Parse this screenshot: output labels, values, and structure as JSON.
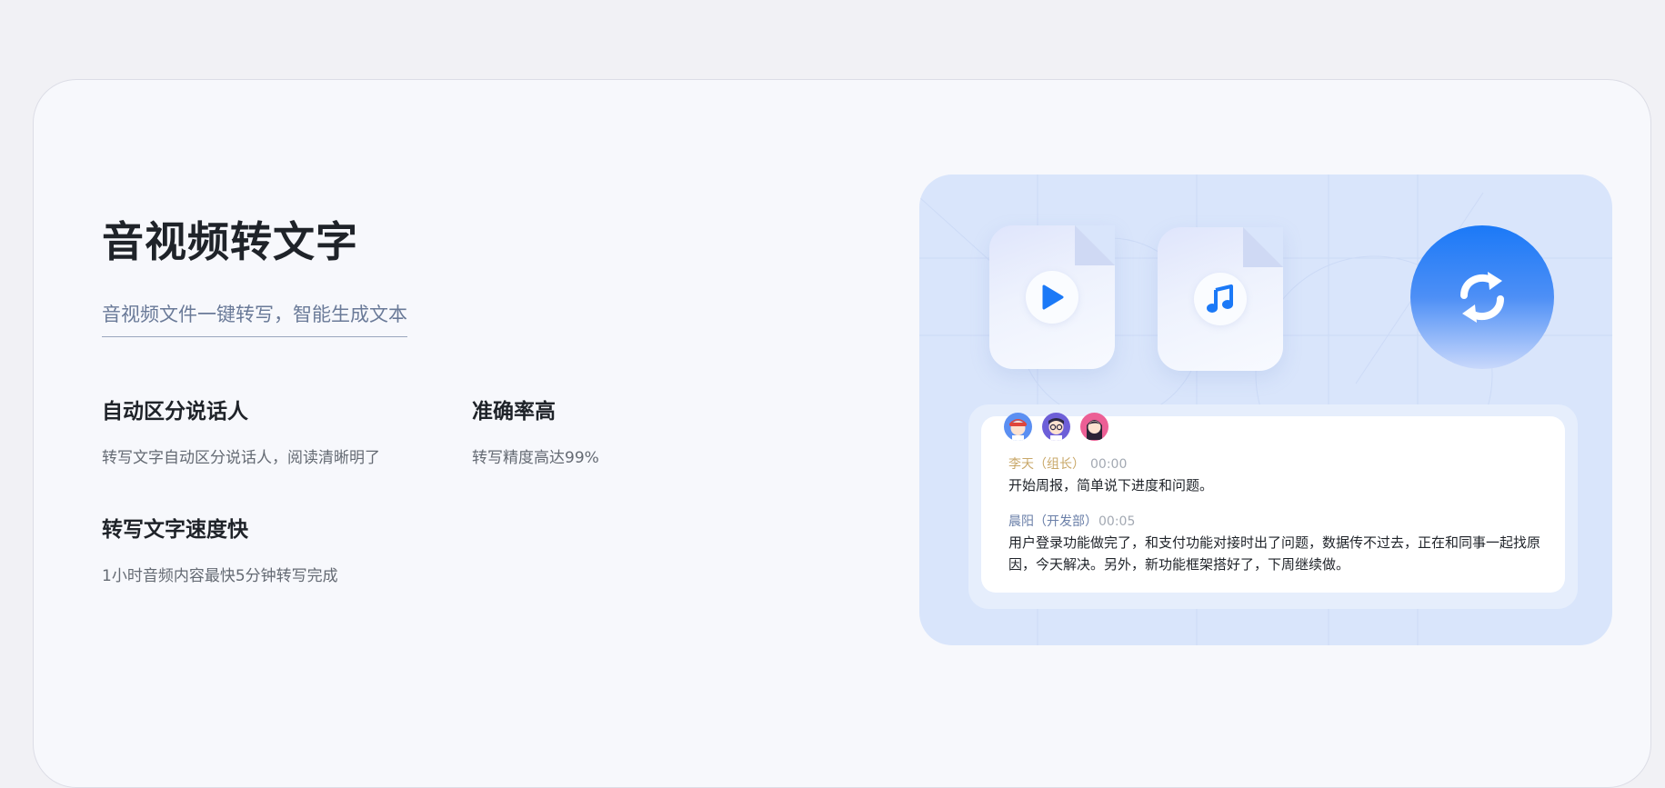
{
  "hero": {
    "title": "音视频转文字",
    "subtitle": "音视频文件一键转写，智能生成文本"
  },
  "features": [
    {
      "title": "自动区分说话人",
      "desc": "转写文字自动区分说话人，阅读清晰明了"
    },
    {
      "title": "准确率高",
      "desc": "转写精度高达99%"
    },
    {
      "title": "转写文字速度快",
      "desc": "1小时音频内容最快5分钟转写完成"
    }
  ],
  "illustration": {
    "icons": [
      "video-file-icon",
      "audio-file-icon",
      "sync-icon"
    ],
    "accent": "#1b79f7",
    "transcript": [
      {
        "speaker": "李天（组长）",
        "time": "00:00",
        "text": "开始周报，简单说下进度和问题。"
      },
      {
        "speaker": "晨阳（开发部）",
        "time": "00:05",
        "text": "用户登录功能做完了，和支付功能对接时出了问题，数据传不过去，正在和同事一起找原因，今天解决。另外，新功能框架搭好了，下周继续做。"
      }
    ]
  }
}
